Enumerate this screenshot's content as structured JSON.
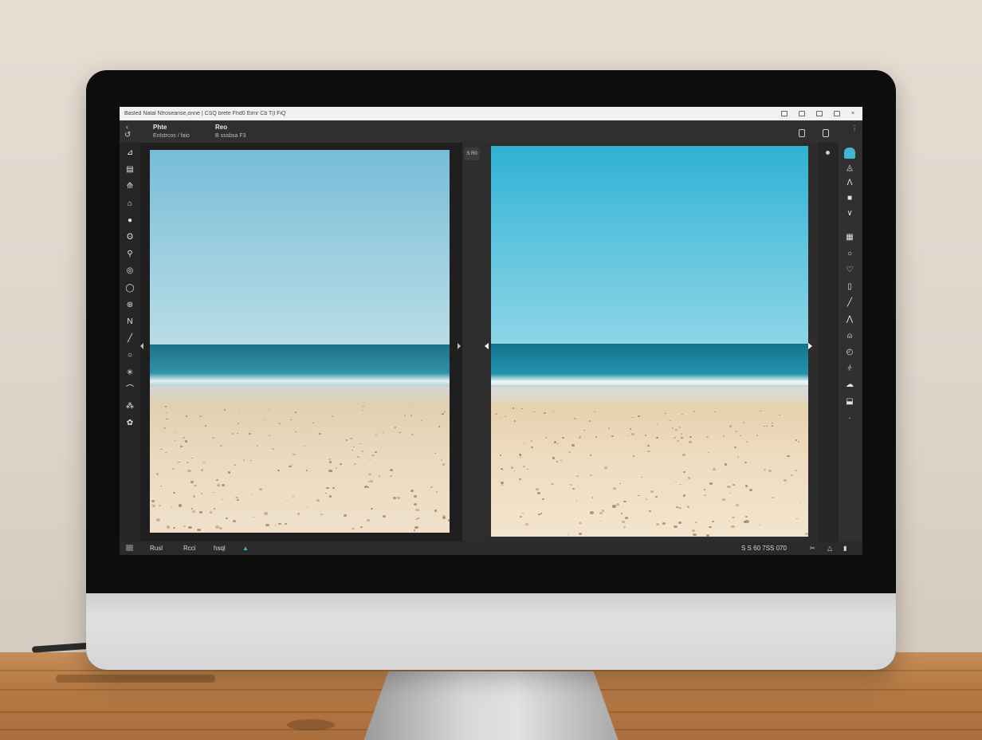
{
  "window": {
    "title": "Basled Natal Nfroseanse,onne | CSQ brete Fhd0 Eirnr Cb T(l FiQ"
  },
  "app": {
    "breadcrumbs": [
      {
        "title": "Phte",
        "sub": "Enlstrcos / faio"
      },
      {
        "title": "Reo",
        "sub": "B  sssbsa F3"
      }
    ],
    "compare_badge": "S R0"
  },
  "left_tools": [
    {
      "icon": "brush-icon",
      "glyph": "⊿"
    },
    {
      "icon": "layers-icon",
      "glyph": "▤"
    },
    {
      "icon": "pen-icon",
      "glyph": "⟰"
    },
    {
      "icon": "stamp-icon",
      "glyph": "⌂"
    },
    {
      "icon": "circle-icon",
      "glyph": "●"
    },
    {
      "icon": "lens-icon",
      "glyph": "Ꙩ"
    },
    {
      "icon": "dropper-icon",
      "glyph": "⚲"
    },
    {
      "icon": "target-icon",
      "glyph": "◎"
    },
    {
      "icon": "shield-icon",
      "glyph": "◯"
    },
    {
      "icon": "eye-icon",
      "glyph": "⊛"
    },
    {
      "icon": "wave-icon",
      "glyph": "N"
    },
    {
      "icon": "line-icon",
      "glyph": "╱"
    },
    {
      "icon": "ring-icon",
      "glyph": "○"
    },
    {
      "icon": "sparkle-icon",
      "glyph": "✳"
    },
    {
      "icon": "curve-icon",
      "glyph": "⌒"
    },
    {
      "icon": "link-icon",
      "glyph": "⁂"
    },
    {
      "icon": "settings-icon",
      "glyph": "✿"
    }
  ],
  "right_tools": [
    {
      "icon": "exposure-icon",
      "glyph": "⌂",
      "active": true
    },
    {
      "icon": "drop-icon",
      "glyph": "◬"
    },
    {
      "icon": "peak-icon",
      "glyph": "ᐱ"
    },
    {
      "icon": "swatch-icon",
      "glyph": "■"
    },
    {
      "icon": "chevron-icon",
      "glyph": "∨"
    },
    {
      "icon": "grid-icon",
      "glyph": "▦"
    },
    {
      "icon": "circle-outline-icon",
      "glyph": "○"
    },
    {
      "icon": "heart-icon",
      "glyph": "♡"
    },
    {
      "icon": "book-icon",
      "glyph": "▯"
    },
    {
      "icon": "slash-icon",
      "glyph": "╱"
    },
    {
      "icon": "triangle-icon",
      "glyph": "⋀"
    },
    {
      "icon": "bell-icon",
      "glyph": "⍝"
    },
    {
      "icon": "dial-icon",
      "glyph": "◴"
    },
    {
      "icon": "split-icon",
      "glyph": "⫩"
    },
    {
      "icon": "cloud-icon",
      "glyph": "☁"
    },
    {
      "icon": "frame-icon",
      "glyph": "⬓"
    },
    {
      "icon": "dot-icon",
      "glyph": "·"
    }
  ],
  "status": {
    "left": [
      "Rusl",
      "Rcci",
      "hsql"
    ],
    "right": "S  S  60  7SS 070"
  },
  "colors": {
    "accent": "#3fb6d6",
    "before_sky": "#84c3da",
    "after_sky": "#3ab4d4"
  }
}
